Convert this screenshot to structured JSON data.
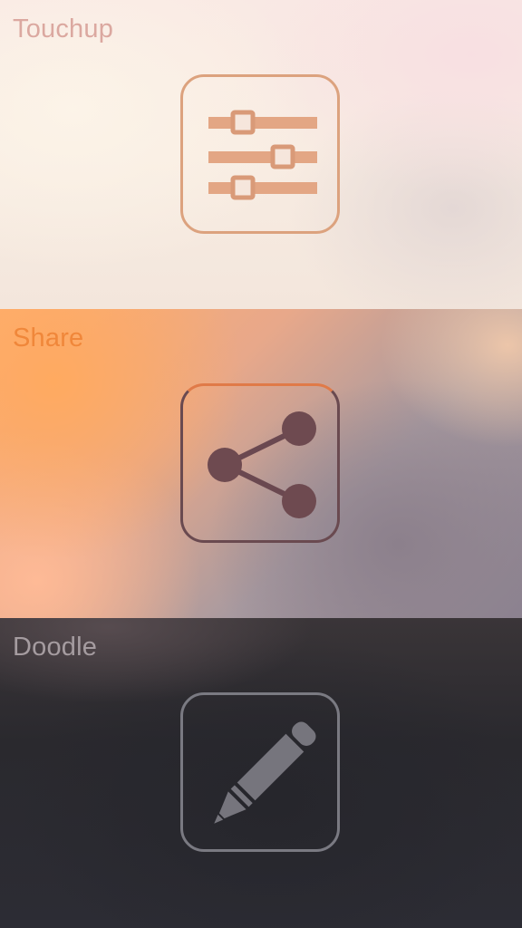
{
  "panels": [
    {
      "id": "touchup",
      "title": "Touchup",
      "icon": "sliders-icon",
      "accent": "#dca27e"
    },
    {
      "id": "share",
      "title": "Share",
      "icon": "share-icon",
      "accent": "#f0873a"
    },
    {
      "id": "doodle",
      "title": "Doodle",
      "icon": "pencil-icon",
      "accent": "#7a7a82"
    }
  ]
}
